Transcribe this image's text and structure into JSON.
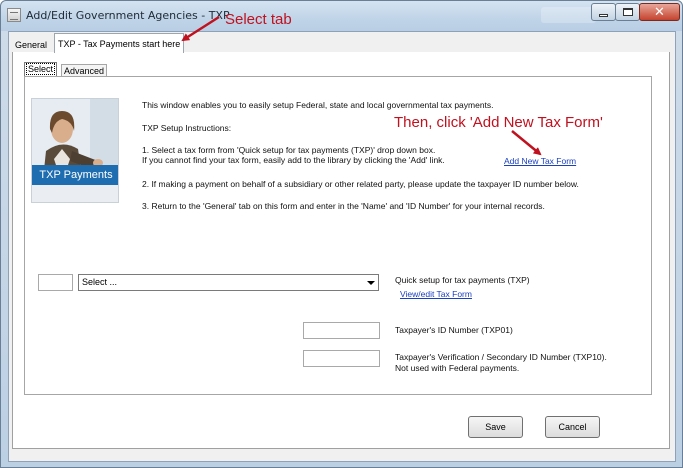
{
  "window": {
    "title": "Add/Edit Government Agencies - TXP"
  },
  "tabs": {
    "general": "General",
    "txp": "TXP - Tax Payments start here"
  },
  "subtabs": {
    "select": "Select",
    "advanced": "Advanced"
  },
  "promo": {
    "label": "TXP Payments"
  },
  "instructions": {
    "intro": "This window enables you to easily setup Federal, state and local governmental tax payments.",
    "heading": "TXP Setup Instructions:",
    "step1a": "1. Select a tax form from 'Quick setup for tax payments (TXP)' drop down box.",
    "step1b": "If you cannot find your tax form, easily add to the library by clicking the 'Add' link.",
    "step2": "2. If making a payment on behalf of a subsidiary or other related party, please update the taxpayer ID number below.",
    "step3": "3. Return to the 'General' tab on this form and enter in the 'Name' and 'ID Number' for your internal records."
  },
  "links": {
    "add_new_tax_form": "Add New Tax Form",
    "view_edit_tax_form": "View/edit Tax Form"
  },
  "annotations": {
    "select_tab": "Select tab",
    "add_form": "Then, click 'Add New Tax Form'"
  },
  "form": {
    "quick_setup": {
      "selected": "Select ...",
      "label": "Quick setup for tax payments (TXP)"
    },
    "taxpayer_id": {
      "label": "Taxpayer's ID Number (TXP01)",
      "value": ""
    },
    "verification_id": {
      "label": "Taxpayer's Verification / Secondary ID Number (TXP10).",
      "note": "Not used with Federal payments.",
      "value": ""
    }
  },
  "buttons": {
    "save": "Save",
    "cancel": "Cancel"
  },
  "colors": {
    "annotation": "#c0111f",
    "link": "#1a3fbf",
    "promo_banner": "#1f6db1"
  }
}
